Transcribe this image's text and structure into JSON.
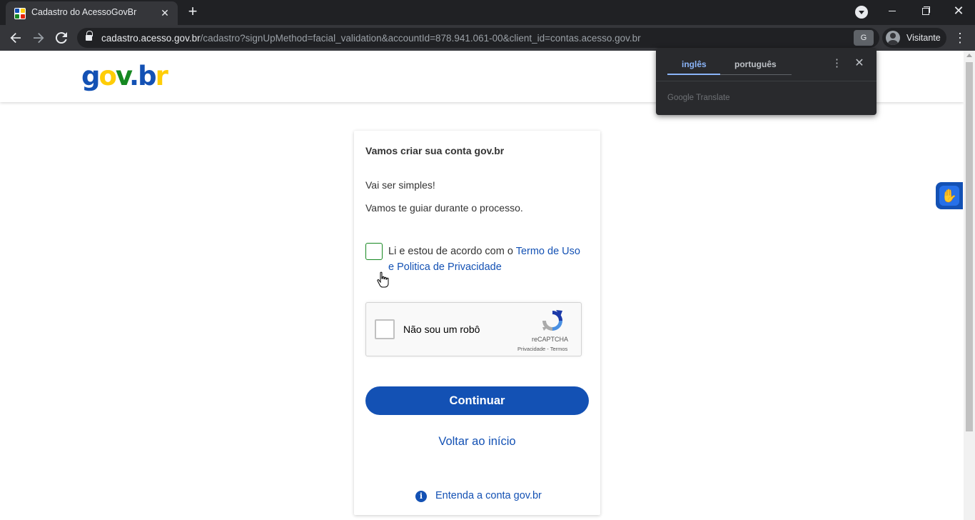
{
  "browser": {
    "tab": {
      "title": "Cadastro do AcessoGovBr",
      "close_icon": "close-icon"
    },
    "new_tab_label": "+",
    "url": {
      "host": "cadastro.acesso.gov.br",
      "path": "/cadastro?signUpMethod=facial_validation&accountId=878.941.061-00&client_id=contas.acesso.gov.br"
    },
    "profile_label": "Visitante",
    "window_controls": {
      "close": "✕"
    }
  },
  "translate_popup": {
    "tabs": [
      "inglês",
      "português"
    ],
    "active_tab": "inglês",
    "footer": "Google Translate"
  },
  "site": {
    "logo": {
      "part1": "g",
      "part2": "o",
      "part3": "v",
      "part4": ".",
      "part5": "b",
      "part6": "r"
    }
  },
  "card": {
    "title": "Vamos criar sua conta gov.br",
    "intro1": "Vai ser simples!",
    "intro2": "Vamos te guiar durante o processo.",
    "terms_prefix": "Li e estou de acordo com o ",
    "terms_link": "Termo de Uso e Politica de Privacidade",
    "terms_checked": false,
    "recaptcha": {
      "label": "Não sou um robô",
      "brand": "reCAPTCHA",
      "links": "Privacidade - Termos"
    },
    "continue_label": "Continuar",
    "back_label": "Voltar ao início",
    "help_label": "Entenda a conta gov.br"
  },
  "colors": {
    "primary": "#1351b4",
    "checkbox_border": "#168821",
    "logo_yellow": "#ffcd07",
    "logo_green": "#168821",
    "chrome_dark": "#202124"
  }
}
